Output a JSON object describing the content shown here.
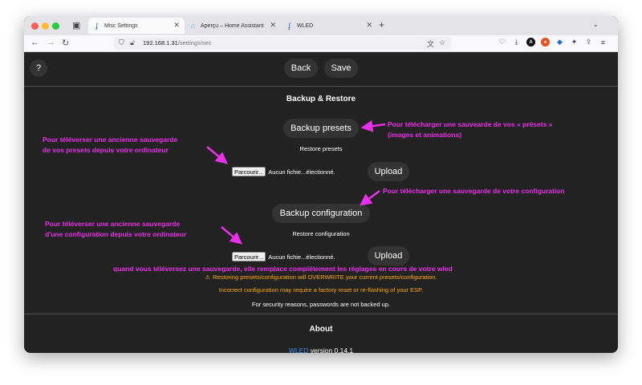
{
  "browser": {
    "tabs": [
      {
        "label": "Misc Settings",
        "active": true
      },
      {
        "label": "Aperçu – Home Assistant",
        "active": false
      },
      {
        "label": "WLED",
        "active": false
      }
    ],
    "url_host": "192.168.1.31",
    "url_path": "/settings/sec"
  },
  "page": {
    "help_label": "?",
    "back_label": "Back",
    "save_label": "Save",
    "section_title": "Backup & Restore",
    "backup_presets_label": "Backup presets",
    "restore_presets_label": "Restore presets",
    "browse_label": "Parcourir...",
    "no_file_label": "Aucun fichie...électionné.",
    "upload_label": "Upload",
    "backup_config_label": "Backup configuration",
    "restore_config_label": "Restore configuration",
    "warning_text": "Restoring presets/configuration will OVERWRITE your current presets/configuration.",
    "warning_text2": "Incorrect configuration may require a factory reset or re-flashing of your ESP.",
    "security_text": "For security reasons, passwords are not backed up.",
    "about_title": "About",
    "about_link": "WLED",
    "about_version": "version 0.14.1"
  },
  "annotations": {
    "upload_presets_note_1": "Pour téléverser une ancienne sauvegarde",
    "upload_presets_note_2": "de vos presets depuis votre ordinateur",
    "download_presets_note_1": "Pour télécharger une sauvearde de vos « présets »",
    "download_presets_note_2": "(images et animations)",
    "download_config_note": "Pour télécharger une sauvegarde de votre configuration",
    "upload_config_note_1": "Pour téléverser une ancienne sauvegarde",
    "upload_config_note_2": "d'une configuration depuis votre ordinateur",
    "replace_note": "quand vous téléversez une sauvegarde, elle remplace complétement les réglages en cours de votre wled",
    "color": "#e830e8"
  },
  "colors": {
    "background": "#222222",
    "button": "#333333",
    "warning": "#ffaa00",
    "link": "#3f8ef0"
  }
}
